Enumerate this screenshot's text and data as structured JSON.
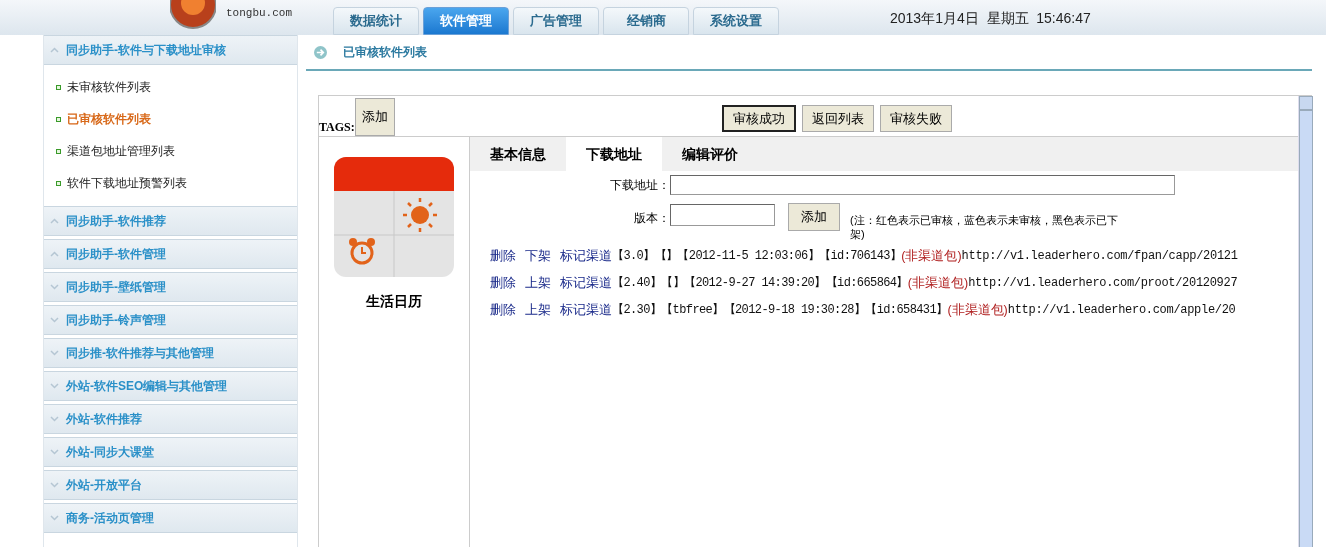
{
  "logo": {
    "domain": "tongbu.com"
  },
  "nav_tabs": [
    {
      "label": "数据统计",
      "selected": false
    },
    {
      "label": "软件管理",
      "selected": true
    },
    {
      "label": "广告管理",
      "selected": false
    },
    {
      "label": "经销商",
      "selected": false
    },
    {
      "label": "系统设置",
      "selected": false
    }
  ],
  "datetime": "2013年1月4日  星期五  15:46:47",
  "sidebar": [
    {
      "title": "同步助手-软件与下载地址审核",
      "expanded": true,
      "items": [
        {
          "label": "未审核软件列表",
          "selected": false
        },
        {
          "label": "已审核软件列表",
          "selected": true
        },
        {
          "label": "渠道包地址管理列表",
          "selected": false
        },
        {
          "label": "软件下载地址预警列表",
          "selected": false
        }
      ]
    },
    {
      "title": "同步助手-软件推荐",
      "expanded": true
    },
    {
      "title": "同步助手-软件管理",
      "expanded": true
    },
    {
      "title": "同步助手-壁纸管理",
      "expanded": false
    },
    {
      "title": "同步助手-铃声管理",
      "expanded": false
    },
    {
      "title": "同步推-软件推荐与其他管理",
      "expanded": false
    },
    {
      "title": "外站-软件SEO编辑与其他管理",
      "expanded": false
    },
    {
      "title": "外站-软件推荐",
      "expanded": false
    },
    {
      "title": "外站-同步大课堂",
      "expanded": false
    },
    {
      "title": "外站-开放平台",
      "expanded": false
    },
    {
      "title": "商务-活动页管理",
      "expanded": false
    }
  ],
  "breadcrumb": "已审核软件列表",
  "tags_label": "TAGS:",
  "tags_add_button": "添加",
  "action_buttons": [
    {
      "label": "审核成功",
      "selected": true
    },
    {
      "label": "返回列表",
      "selected": false
    },
    {
      "label": "审核失败",
      "selected": false
    }
  ],
  "app": {
    "name": "生活日历"
  },
  "detail_tabs": [
    {
      "label": "基本信息",
      "selected": false
    },
    {
      "label": "下载地址",
      "selected": true
    },
    {
      "label": "编辑评价",
      "selected": false
    }
  ],
  "form": {
    "url_label": "下载地址：",
    "version_label": "版本：",
    "add_button": "添加",
    "note": "(注：红色表示已审核，蓝色表示未审核，黑色表示已下架)"
  },
  "downloads": [
    {
      "delete": "删除",
      "toggle": "下架",
      "mark": "标记渠道",
      "version": "【3.0】",
      "tag": "【】",
      "time": "【2012-11-5 12:03:06】",
      "id": "【id:706143】",
      "channel": "(非渠道包)",
      "url": "http://v1.leaderhero.com/fpan/capp/20121"
    },
    {
      "delete": "删除",
      "toggle": "上架",
      "mark": "标记渠道",
      "version": "【2.40】",
      "tag": "【】",
      "time": "【2012-9-27 14:39:20】",
      "id": "【id:665864】",
      "channel": "(非渠道包)",
      "url": "http://v1.leaderhero.com/proot/20120927"
    },
    {
      "delete": "删除",
      "toggle": "上架",
      "mark": "标记渠道",
      "version": "【2.30】",
      "tag": "【tbfree】",
      "time": "【2012-9-18 19:30:28】",
      "id": "【id:658431】",
      "channel": "(非渠道包)",
      "url": "http://v1.leaderhero.com/apple/20"
    }
  ]
}
